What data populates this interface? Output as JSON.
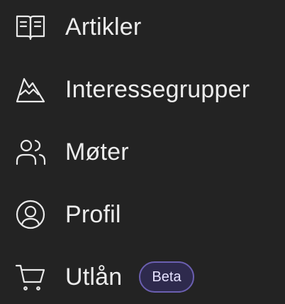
{
  "menu": {
    "items": [
      {
        "icon": "book-open-icon",
        "label": "Artikler"
      },
      {
        "icon": "mountain-icon",
        "label": "Interessegrupper"
      },
      {
        "icon": "users-icon",
        "label": "Møter"
      },
      {
        "icon": "user-circle-icon",
        "label": "Profil"
      },
      {
        "icon": "shopping-cart-icon",
        "label": "Utlån",
        "badge": "Beta"
      }
    ]
  },
  "colors": {
    "background": "#232323",
    "text": "#ececec",
    "badge_border": "#6b5fb0",
    "badge_background": "#2e2a4d"
  }
}
